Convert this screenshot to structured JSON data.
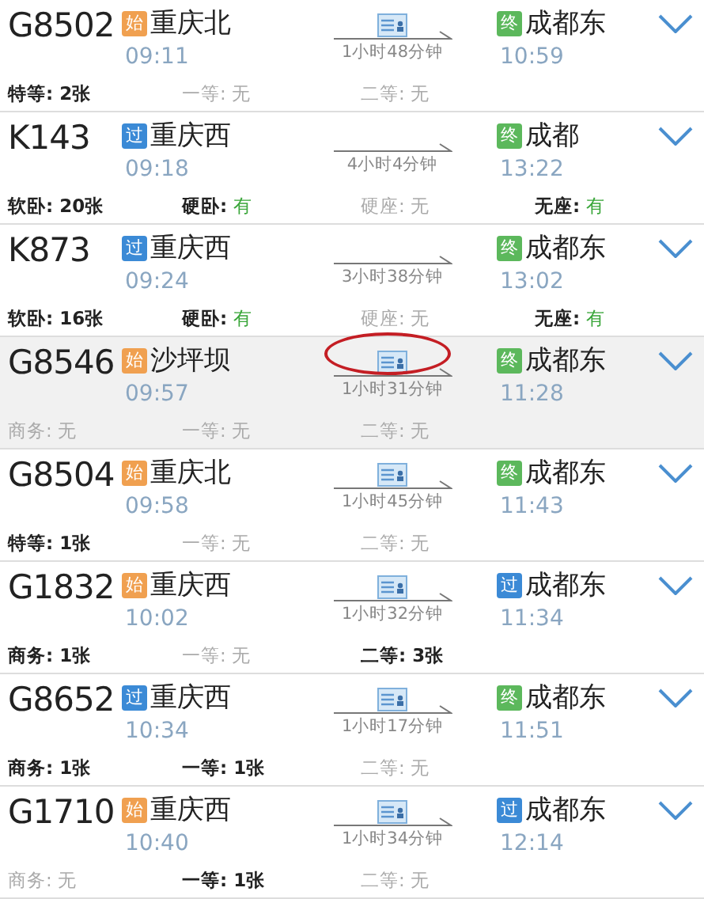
{
  "trains": [
    {
      "number": "G8502",
      "selected": false,
      "from": {
        "badge": "始",
        "kind": "start",
        "station": "重庆北",
        "time": "09:11"
      },
      "id_ticket": true,
      "circled": false,
      "duration": "1小时48分钟",
      "to": {
        "badge": "终",
        "kind": "end",
        "station": "成都东",
        "time": "10:59"
      },
      "seats": [
        {
          "label": "特等:",
          "value": "2张",
          "kind": "count",
          "available": true
        },
        {
          "label": "一等:",
          "value": "无",
          "available": false
        },
        {
          "label": "二等:",
          "value": "无",
          "available": false
        }
      ]
    },
    {
      "number": "K143",
      "selected": false,
      "from": {
        "badge": "过",
        "kind": "pass",
        "station": "重庆西",
        "time": "09:18"
      },
      "id_ticket": false,
      "circled": false,
      "duration": "4小时4分钟",
      "to": {
        "badge": "终",
        "kind": "end",
        "station": "成都",
        "time": "13:22"
      },
      "seats": [
        {
          "label": "软卧:",
          "value": "20张",
          "kind": "count",
          "available": true
        },
        {
          "label": "硬卧:",
          "value": "有",
          "kind": "yes",
          "available": true
        },
        {
          "label": "硬座:",
          "value": "无",
          "available": false
        },
        {
          "label": "无座:",
          "value": "有",
          "kind": "yes",
          "available": true
        }
      ]
    },
    {
      "number": "K873",
      "selected": false,
      "from": {
        "badge": "过",
        "kind": "pass",
        "station": "重庆西",
        "time": "09:24"
      },
      "id_ticket": false,
      "circled": false,
      "duration": "3小时38分钟",
      "to": {
        "badge": "终",
        "kind": "end",
        "station": "成都东",
        "time": "13:02"
      },
      "seats": [
        {
          "label": "软卧:",
          "value": "16张",
          "kind": "count",
          "available": true
        },
        {
          "label": "硬卧:",
          "value": "有",
          "kind": "yes",
          "available": true
        },
        {
          "label": "硬座:",
          "value": "无",
          "available": false
        },
        {
          "label": "无座:",
          "value": "有",
          "kind": "yes",
          "available": true
        }
      ]
    },
    {
      "number": "G8546",
      "selected": true,
      "from": {
        "badge": "始",
        "kind": "start",
        "station": "沙坪坝",
        "time": "09:57"
      },
      "id_ticket": true,
      "circled": true,
      "duration": "1小时31分钟",
      "to": {
        "badge": "终",
        "kind": "end",
        "station": "成都东",
        "time": "11:28"
      },
      "seats": [
        {
          "label": "商务:",
          "value": "无",
          "available": false
        },
        {
          "label": "一等:",
          "value": "无",
          "available": false
        },
        {
          "label": "二等:",
          "value": "无",
          "available": false
        }
      ]
    },
    {
      "number": "G8504",
      "selected": false,
      "from": {
        "badge": "始",
        "kind": "start",
        "station": "重庆北",
        "time": "09:58"
      },
      "id_ticket": true,
      "circled": false,
      "duration": "1小时45分钟",
      "to": {
        "badge": "终",
        "kind": "end",
        "station": "成都东",
        "time": "11:43"
      },
      "seats": [
        {
          "label": "特等:",
          "value": "1张",
          "kind": "count",
          "available": true
        },
        {
          "label": "一等:",
          "value": "无",
          "available": false
        },
        {
          "label": "二等:",
          "value": "无",
          "available": false
        }
      ]
    },
    {
      "number": "G1832",
      "selected": false,
      "from": {
        "badge": "始",
        "kind": "start",
        "station": "重庆西",
        "time": "10:02"
      },
      "id_ticket": true,
      "circled": false,
      "duration": "1小时32分钟",
      "to": {
        "badge": "过",
        "kind": "pass",
        "station": "成都东",
        "time": "11:34"
      },
      "seats": [
        {
          "label": "商务:",
          "value": "1张",
          "kind": "count",
          "available": true
        },
        {
          "label": "一等:",
          "value": "无",
          "available": false
        },
        {
          "label": "二等:",
          "value": "3张",
          "kind": "count",
          "available": true
        }
      ]
    },
    {
      "number": "G8652",
      "selected": false,
      "from": {
        "badge": "过",
        "kind": "pass",
        "station": "重庆西",
        "time": "10:34"
      },
      "id_ticket": true,
      "circled": false,
      "duration": "1小时17分钟",
      "to": {
        "badge": "终",
        "kind": "end",
        "station": "成都东",
        "time": "11:51"
      },
      "seats": [
        {
          "label": "商务:",
          "value": "1张",
          "kind": "count",
          "available": true
        },
        {
          "label": "一等:",
          "value": "1张",
          "kind": "count",
          "available": true
        },
        {
          "label": "二等:",
          "value": "无",
          "available": false
        }
      ]
    },
    {
      "number": "G1710",
      "selected": false,
      "from": {
        "badge": "始",
        "kind": "start",
        "station": "重庆西",
        "time": "10:40"
      },
      "id_ticket": true,
      "circled": false,
      "duration": "1小时34分钟",
      "to": {
        "badge": "过",
        "kind": "pass",
        "station": "成都东",
        "time": "12:14"
      },
      "seats": [
        {
          "label": "商务:",
          "value": "无",
          "available": false
        },
        {
          "label": "一等:",
          "value": "1张",
          "kind": "count",
          "available": true
        },
        {
          "label": "二等:",
          "value": "无",
          "available": false
        }
      ]
    }
  ]
}
